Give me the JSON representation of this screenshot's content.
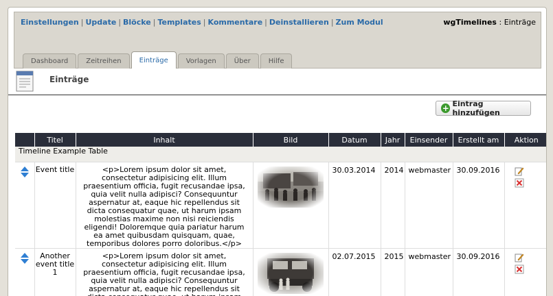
{
  "menu": [
    {
      "label": "Einstellungen"
    },
    {
      "label": "Update"
    },
    {
      "label": "Blöcke"
    },
    {
      "label": "Templates"
    },
    {
      "label": "Kommentare"
    },
    {
      "label": "Deinstallieren"
    },
    {
      "label": "Zum Modul"
    }
  ],
  "module": {
    "name": "wgTimelines",
    "separator": ":",
    "section": "Einträge"
  },
  "tabs": [
    {
      "label": "Dashboard"
    },
    {
      "label": "Zeitreihen"
    },
    {
      "label": "Einträge",
      "active": true
    },
    {
      "label": "Vorlagen"
    },
    {
      "label": "Über"
    },
    {
      "label": "Hilfe"
    }
  ],
  "page": {
    "title": "Einträge",
    "add_button": "Eintrag hinzufügen"
  },
  "table": {
    "headers": [
      "",
      "Titel",
      "Inhalt",
      "Bild",
      "Datum",
      "Jahr",
      "Einsender",
      "Erstellt am",
      "Aktion"
    ],
    "group": "Timeline Example Table",
    "rows": [
      {
        "title": "Event title",
        "content": "<p>Lorem ipsum dolor sit amet, consectetur adipisicing elit. Illum praesentium officia, fugit recusandae ipsa, quia velit nulla adipisci? Consequuntur aspernatur at, eaque hic repellendus sit dicta consequatur quae, ut harum ipsam molestias maxime non nisi reiciendis eligendi! Doloremque quia pariatur harum ea amet quibusdam quisquam, quae, temporibus dolores porro doloribus.</p>",
        "image": "crowd-photo",
        "date": "30.03.2014",
        "year": "2014",
        "submitter": "webmaster",
        "created": "30.09.2016"
      },
      {
        "title": "Another event title 1",
        "content": "<p>Lorem ipsum dolor sit amet, consectetur adipisicing elit. Illum praesentium officia, fugit recusandae ipsa, quia velit nulla adipisci? Consequuntur aspernatur at, eaque hic repellendus sit dicta consequatur quae, ut harum ipsam",
        "image": "truck-photo",
        "date": "02.07.2015",
        "year": "2015",
        "submitter": "webmaster",
        "created": "30.09.2016"
      }
    ]
  },
  "icons": {
    "sort": "sort-arrows-icon",
    "edit": "edit-icon",
    "delete": "delete-icon",
    "add": "add-icon",
    "page": "document-icon"
  },
  "colors": {
    "link": "#2a6aa8",
    "header_bg": "#2a2e3a",
    "add_green": "#3c9a2e",
    "delete_red": "#d83030"
  }
}
